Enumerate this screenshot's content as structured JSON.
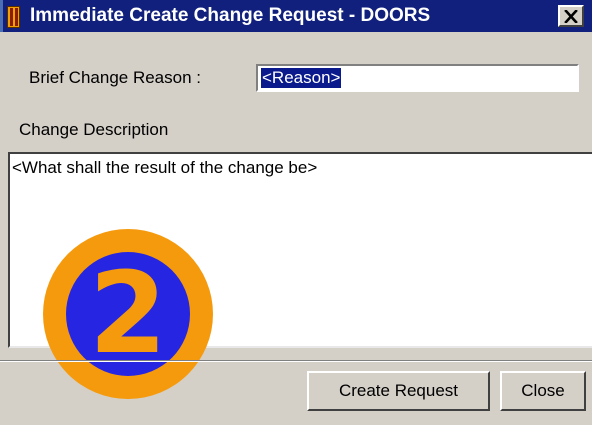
{
  "window": {
    "title": "Immediate Create Change Request - DOORS",
    "app_icon": "doors-app-icon",
    "close_icon": "close-icon"
  },
  "form": {
    "reason_label": "Brief Change Reason :",
    "reason_value": "<Reason>",
    "description_label": "Change Description",
    "description_value": "<What shall the result of the change be>"
  },
  "annotation": {
    "step_number": "2",
    "colors": {
      "ring": "#f59a0c",
      "fill": "#2626e2"
    }
  },
  "buttons": {
    "create_label": "Create Request",
    "close_label": "Close"
  }
}
